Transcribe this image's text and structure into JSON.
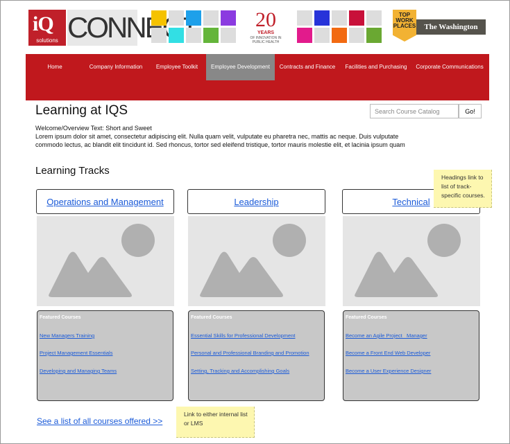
{
  "header": {
    "iq_logo": {
      "big": "iQ",
      "small": "solutions"
    },
    "connect_logo": "CONNECT",
    "years_badge": {
      "num": "20",
      "label": "YEARS",
      "sub": "OF INNOVATION IN PUBLIC HEALTH"
    },
    "award_badge": "TOP WORK PLACES",
    "newspaper": "The Washington Post",
    "tiles_left": [
      "#f5c200",
      "#dddddd",
      "#1ea0ea",
      "#dddddd",
      "#8b3be0",
      "#dddddd",
      "#32dfe4",
      "#dddddd",
      "#64b53a",
      "#dddddd"
    ],
    "tiles_right": [
      "#dddddd",
      "#2733d9",
      "#dddddd",
      "#c8103a",
      "#dddddd",
      "#e21b8c",
      "#dddddd",
      "#f26a12",
      "#dddddd",
      "#6aa832"
    ]
  },
  "nav": {
    "items": [
      {
        "label": "Home"
      },
      {
        "label": "Company Information"
      },
      {
        "label": "Employee Toolkit"
      },
      {
        "label": "Employee Development"
      },
      {
        "label": "Contracts and Finance"
      },
      {
        "label": "Facilities and Purchasing"
      },
      {
        "label": "Corporate Communications"
      }
    ],
    "active_index": 3
  },
  "page": {
    "title": "Learning at IQS",
    "welcome": "Welcome/Overview Text: Short and Sweet",
    "lorem": "Lorem ipsum dolor sit amet, consectetur adipiscing elit. Nulla quam velit, vulputate eu pharetra nec, mattis ac neque. Duis vulputate commodo lectus, ac blandit elit tincidunt id. Sed rhoncus, tortor sed eleifend tristique, tortor mauris molestie elit, et lacinia ipsum quam"
  },
  "search": {
    "placeholder": "Search Course Catalog",
    "button": "Go!"
  },
  "tracks_section": {
    "title": "Learning Tracks",
    "featured_heading": "Featured Courses"
  },
  "tracks": [
    {
      "title": "Operations and Management",
      "courses": [
        "New Managers Training",
        "Project Management Essentials",
        "Developing and Managing Teams"
      ]
    },
    {
      "title": "Leadership",
      "courses": [
        "Essential Skills for Professional Development",
        "Personal and Professional Branding and Promotion",
        "Setting, Tracking and Accomplishing Goals"
      ]
    },
    {
      "title": "Technical",
      "courses": [
        "Become an Agile Project   Manager",
        "Become a Front End Web Developer",
        "Become a User Experience Designer"
      ]
    }
  ],
  "all_courses_link": "See a list of all courses offered >>",
  "notes": {
    "headings": "Headings link to list of track-specific courses.",
    "link": "Link to either internal list or LMS"
  }
}
